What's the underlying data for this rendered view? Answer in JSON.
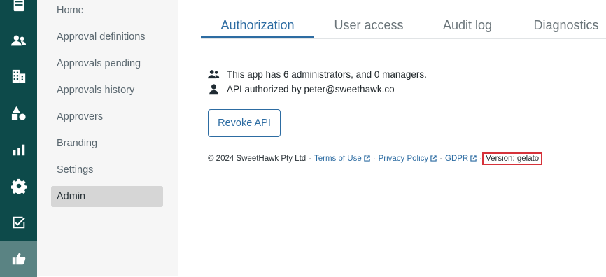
{
  "rail": {
    "icons": [
      {
        "name": "database-icon"
      },
      {
        "name": "users-icon"
      },
      {
        "name": "buildings-icon"
      },
      {
        "name": "shapes-icon"
      },
      {
        "name": "bar-chart-icon"
      },
      {
        "name": "gear-icon"
      },
      {
        "name": "checkbox-icon"
      },
      {
        "name": "thumbs-up-icon"
      }
    ],
    "active_color": "#5a8383",
    "bg_color": "#0d4a4a"
  },
  "subnav": {
    "items": [
      {
        "label": "Home"
      },
      {
        "label": "Approval definitions"
      },
      {
        "label": "Approvals pending"
      },
      {
        "label": "Approvals history"
      },
      {
        "label": "Approvers"
      },
      {
        "label": "Branding"
      },
      {
        "label": "Settings"
      },
      {
        "label": "Admin",
        "active": true
      }
    ]
  },
  "tabs": {
    "items": [
      {
        "label": "Authorization",
        "active": true
      },
      {
        "label": "User access"
      },
      {
        "label": "Audit log"
      },
      {
        "label": "Diagnostics"
      }
    ],
    "accent": "#2d6ca2"
  },
  "info": {
    "admins_text": "This app has 6 administrators, and 0 managers.",
    "api_text": "API authorized by peter@sweethawk.co"
  },
  "revoke_button": {
    "label": "Revoke API"
  },
  "footer": {
    "copyright": "© 2024 SweetHawk Pty Ltd",
    "sep": "·",
    "terms": "Terms of Use",
    "privacy": "Privacy Policy",
    "gdpr": "GDPR",
    "version": "Version: gelato",
    "highlight_color": "#d6323a"
  }
}
